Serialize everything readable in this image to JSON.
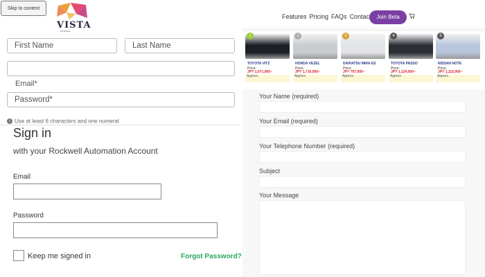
{
  "skip_link": "Skip to content",
  "logo": {
    "text": "VISTA",
    "subtext": "INTERIOR"
  },
  "register": {
    "first_name": "First Name",
    "last_name": "Last Name",
    "email_label": "Email*",
    "password_placeholder": "Password*",
    "hint": "Use at least 6 characters and one numeral"
  },
  "signin": {
    "title": "Sign in",
    "subtitle": "with your Rockwell Automation Account",
    "email_label": "Email",
    "password_label": "Password",
    "keep_signed_in": "Keep me signed in",
    "forgot": "Forgot Password?"
  },
  "nav": {
    "items": [
      "Features",
      "Pricing",
      "FAQs",
      "Contact"
    ],
    "join": "Join Beta",
    "cart_icon": "cart-icon"
  },
  "cars": [
    {
      "rank": "1",
      "name": "TOYOTA VITZ",
      "price_label": "Price:",
      "price": "JPY 1,071,000~",
      "approx": "Approx.",
      "color": "#1c1f26",
      "badge": "#9acd32"
    },
    {
      "rank": "2",
      "name": "HONDA VEZEL",
      "price_label": "Price:",
      "price": "JPY 1,716,000~",
      "approx": "Approx.",
      "color": "#c9ccd1",
      "badge": "#aaaaaa"
    },
    {
      "rank": "3",
      "name": "DAIHATSU MIRA ES",
      "price_label": "Price:",
      "price": "JPY 767,000~",
      "approx": "Approx.",
      "color": "#e2e4e8",
      "badge": "#d8a33a"
    },
    {
      "rank": "4",
      "name": "TOYOTA PASSO",
      "price_label": "Price:",
      "price": "JPY 1,124,000~",
      "approx": "Approx.",
      "color": "#2b2f36",
      "badge": "#555555"
    },
    {
      "rank": "5",
      "name": "NISSAN NOTE",
      "price_label": "Price:",
      "price": "JPY 1,115,000~",
      "approx": "Approx.",
      "color": "#b9c6dc",
      "badge": "#555555"
    }
  ],
  "contact_form": {
    "name_label": "Your Name (required)",
    "email_label": "Your Email (required)",
    "phone_label": "Your Telephone Number (required)",
    "subject_label": "Subject",
    "message_label": "Your Message"
  }
}
